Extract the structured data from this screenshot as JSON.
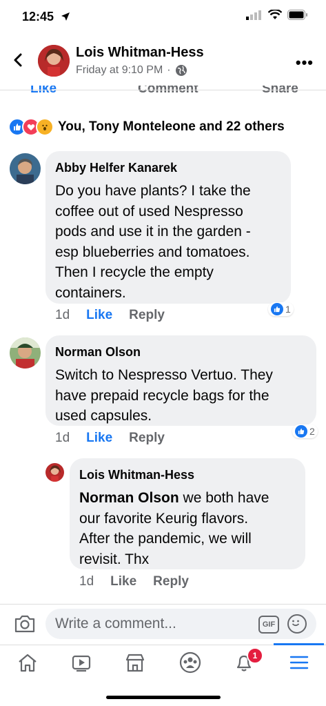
{
  "status_bar": {
    "time": "12:45"
  },
  "header": {
    "name": "Lois Whitman-Hess",
    "timestamp": "Friday at 9:10 PM",
    "separator": "·",
    "more": "•••"
  },
  "post_actions": {
    "like": "Like",
    "comment": "Comment",
    "share": "Share"
  },
  "reactions_summary": "You, Tony Monteleone and 22 others",
  "comments": [
    {
      "author": "Abby Helfer Kanarek",
      "lines": [
        "Do you have plants? I take the",
        "coffee out of used Nespresso",
        "pods and use it in the garden -",
        "esp blueberries and tomatoes.",
        "Then I recycle the empty",
        "containers."
      ],
      "age": "1d",
      "like_label": "Like",
      "reply_label": "Reply",
      "reaction_count": "1"
    },
    {
      "author": "Norman Olson",
      "lines": [
        "Switch to Nespresso Vertuo. They",
        "have prepaid recycle bags for the",
        "used capsules."
      ],
      "age": "1d",
      "like_label": "Like",
      "reply_label": "Reply",
      "reaction_count": "2"
    }
  ],
  "reply": {
    "author": "Lois Whitman-Hess",
    "mention": "Norman Olson",
    "first_line_rest": " we both have",
    "lines": [
      "our favorite  Keurig flavors.",
      "After the pandemic, we will",
      "revisit. Thx"
    ],
    "age": "1d",
    "like_label": "Like",
    "reply_label": "Reply"
  },
  "composer": {
    "placeholder": "Write a comment...",
    "gif_label": "GIF"
  },
  "tabbar": {
    "notification_count": "1"
  },
  "colors": {
    "accent": "#1877f2",
    "bubble": "#eff0f2",
    "secondary_text": "#65676b",
    "love": "#f33e58",
    "wow": "#f7b125",
    "badge_red": "#e41e3f"
  },
  "icons": [
    "back-icon",
    "globe-icon",
    "camera-icon",
    "gif-icon",
    "emoji-icon",
    "home-icon",
    "watch-icon",
    "marketplace-icon",
    "groups-icon",
    "bell-icon",
    "menu-icon"
  ]
}
